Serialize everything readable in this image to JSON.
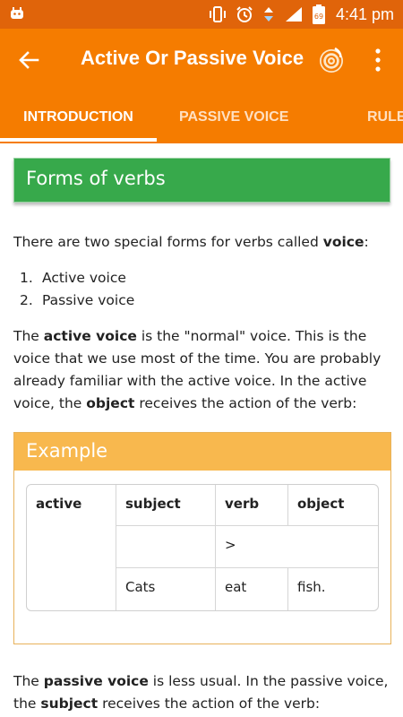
{
  "status_bar": {
    "time": "4:41 pm",
    "battery_level": "69",
    "icons": [
      "android-debug-icon",
      "vibrate-icon",
      "alarm-icon",
      "data-arrows-icon",
      "signal-icon",
      "battery-icon"
    ]
  },
  "app_bar": {
    "title": "Active Or Passive Voice",
    "back_icon": "arrow-back-icon",
    "logo_icon": "app-logo-icon",
    "menu_icon": "more-vert-icon",
    "accent_color": "#f57c00"
  },
  "tabs": [
    {
      "label": "INTRODUCTION",
      "active": true
    },
    {
      "label": "PASSIVE VOICE",
      "active": false
    },
    {
      "label": "RULE",
      "active": false
    }
  ],
  "content": {
    "section_title": "Forms of verbs",
    "intro": {
      "before": "There are two special forms for verbs called ",
      "bold": "voice",
      "after": ":"
    },
    "list": [
      {
        "num": "1.",
        "text": "Active voice"
      },
      {
        "num": "2.",
        "text": "Passive voice"
      }
    ],
    "active_para": {
      "t1": "The ",
      "b1": "active voice",
      "t2": " is the \"normal\" voice. This is the voice that we use most of the time. You are probably already familiar with the active voice. In the active voice, the ",
      "b2": "object",
      "t3": " receives the action of the verb:"
    },
    "example": {
      "title": "Example",
      "row_label": "active",
      "headers": [
        "subject",
        "verb",
        "object"
      ],
      "arrow_row": [
        "",
        ">"
      ],
      "data_row": [
        "Cats",
        "eat",
        "fish."
      ]
    },
    "passive_para": {
      "t1": "The ",
      "b1": "passive voice",
      "t2": " is less usual. In the passive voice, the ",
      "b2": "subject",
      "t3": " receives the action of the verb:"
    },
    "colors": {
      "section_green": "#37a94b",
      "example_orange": "#f8b84e"
    }
  }
}
